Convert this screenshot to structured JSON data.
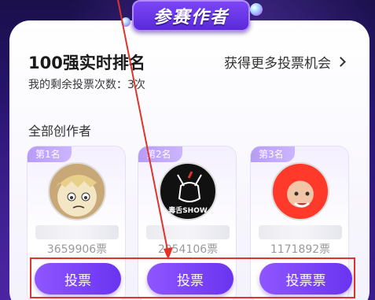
{
  "banner": {
    "title": "参赛作者"
  },
  "ranking": {
    "title": "100强实时排名",
    "more_link": "获得更多投票机会",
    "votes_left": "我的剩余投票次数：3次"
  },
  "section": {
    "label": "全部创作者"
  },
  "creators": [
    {
      "rank": "第1名",
      "count": "3659906票",
      "vote_label": "投票"
    },
    {
      "rank": "第2名",
      "count": "2054106票",
      "vote_label": "投票",
      "avatar_text": "毒舌SHOW"
    },
    {
      "rank": "第3名",
      "count": "1171892票",
      "vote_label": "投票票"
    }
  ],
  "colors": {
    "accent": "#7b46f5",
    "annotation": "#e0332a"
  }
}
